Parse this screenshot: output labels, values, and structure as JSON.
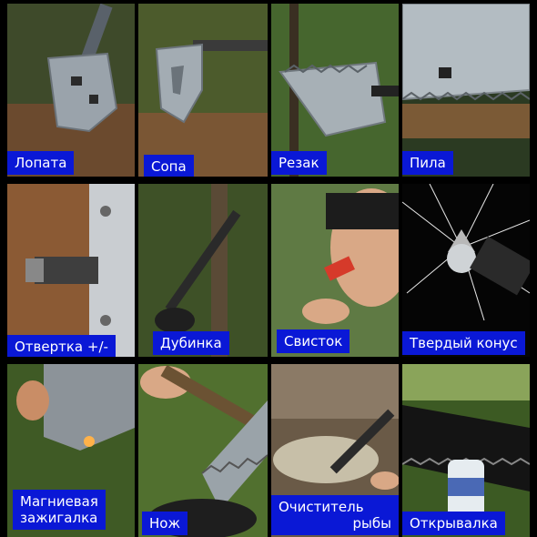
{
  "tiles": [
    {
      "id": "lopata",
      "label": "Лопата"
    },
    {
      "id": "sopa",
      "label": "Сопа"
    },
    {
      "id": "rezak",
      "label": "Резак"
    },
    {
      "id": "pila",
      "label": "Пила"
    },
    {
      "id": "otvertka",
      "label": "Отвертка +/-"
    },
    {
      "id": "dubinka",
      "label": "Дубинка"
    },
    {
      "id": "svistok",
      "label": "Свисток"
    },
    {
      "id": "konus",
      "label": "Твердый конус"
    },
    {
      "id": "zazhigalka",
      "label_line1": "Магниевая",
      "label_line2": "зажигалка"
    },
    {
      "id": "nozh",
      "label": "Нож"
    },
    {
      "id": "ochistitel",
      "label_line1": "Очиститель",
      "label_line2": "рыбы"
    },
    {
      "id": "otkryvalka",
      "label": "Открывалка"
    }
  ],
  "colors": {
    "label_bg": "#0a18d6",
    "label_text": "#ffffff",
    "background": "#000000"
  }
}
